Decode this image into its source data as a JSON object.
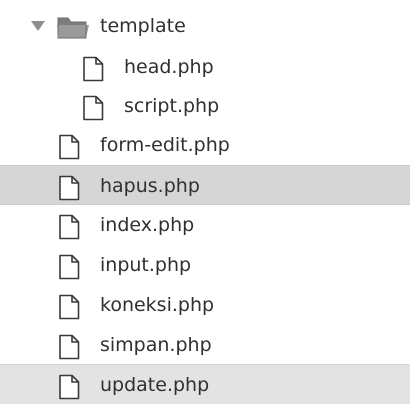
{
  "sidebar": {
    "folder": {
      "name": "template",
      "icon": "folder-open-icon",
      "chevron": "chevron-down-icon",
      "children": [
        {
          "name": "head.php",
          "icon": "file-icon"
        },
        {
          "name": "script.php",
          "icon": "file-icon"
        }
      ]
    },
    "files": [
      {
        "name": "form-edit.php",
        "icon": "file-icon"
      },
      {
        "name": "hapus.php",
        "icon": "file-icon",
        "selected": true
      },
      {
        "name": "index.php",
        "icon": "file-icon"
      },
      {
        "name": "input.php",
        "icon": "file-icon"
      },
      {
        "name": "koneksi.php",
        "icon": "file-icon"
      },
      {
        "name": "simpan.php",
        "icon": "file-icon"
      },
      {
        "name": "update.php",
        "icon": "file-icon"
      }
    ],
    "colors": {
      "selected_row": "#d6d6d6",
      "text": "#303030",
      "icon_stroke": "#3a3a3a"
    }
  }
}
